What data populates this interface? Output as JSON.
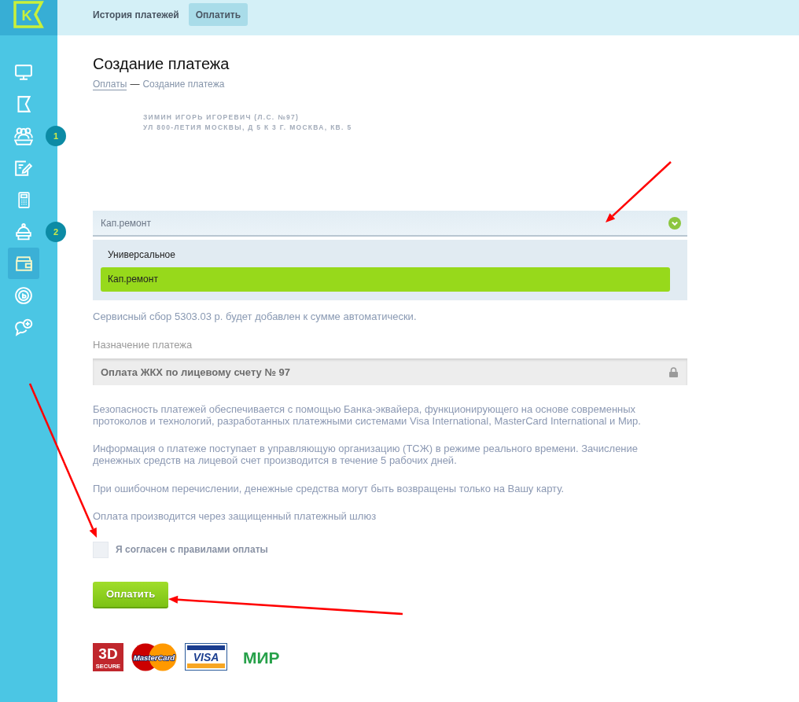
{
  "logo": {
    "text": "K"
  },
  "sidebar": {
    "items": [
      {
        "kind": "monitor",
        "selected": false
      },
      {
        "kind": "flag",
        "selected": false
      },
      {
        "kind": "people",
        "selected": false,
        "badge": "1"
      },
      {
        "kind": "note",
        "selected": false
      },
      {
        "kind": "calculator",
        "selected": false
      },
      {
        "kind": "bell",
        "selected": false,
        "badge": "2"
      },
      {
        "kind": "wallet",
        "selected": true
      },
      {
        "kind": "coin",
        "selected": false
      },
      {
        "kind": "chat",
        "selected": false
      }
    ]
  },
  "tabs": [
    {
      "label": "История платежей",
      "selected": false
    },
    {
      "label": "Оплатить",
      "selected": true
    }
  ],
  "page": {
    "title": "Создание платежа",
    "breadcrumb": {
      "link": "Оплаты",
      "separator": "—",
      "current": "Создание платежа"
    }
  },
  "account": {
    "lines": [
      "ЗИМИН ИГОРЬ ИГОРЕВИЧ (Л.С. №97)",
      "УЛ 800-ЛЕТИЯ МОСКВЫ, Д 5 К 3 Г. МОСКВА, КВ. 5"
    ]
  },
  "service_select": {
    "value": "Кап.ремонт",
    "expanded": true,
    "options": [
      {
        "label": "Универсальное",
        "selected": false
      },
      {
        "label": "Кап.ремонт",
        "selected": true
      }
    ]
  },
  "fee_note": "Сервисный сбор 5303.03 р. будет добавлен к сумме автоматически.",
  "purpose": {
    "label": "Назначение платежа",
    "value": "Оплата ЖКХ по лицевому счету № 97",
    "locked": true
  },
  "notes": [
    "Безопасность платежей обеспечивается с помощью Банка-эквайера, функционирующего на основе современных протоколов и технологий, разработанных платежными системами Visa International, MasterCard International и Мир.",
    "Информация о платеже поступает в управляющую организацию (ТСЖ) в режиме реального времени. Зачисление денежных средств на лицевой счет производится в течение 5 рабочих дней.",
    "При ошибочном перечислении, денежные средства могут быть возвращены только на Вашу карту.",
    "Оплата производится через защищенный платежный шлюз"
  ],
  "agreement": {
    "label": "Я согласен с правилами оплаты",
    "checked": false
  },
  "pay_button": {
    "label": "Оплатить"
  },
  "payment_logos": [
    {
      "kind": "secure",
      "lines": [
        "3D",
        "SECURE"
      ]
    },
    {
      "kind": "mastercard",
      "text": "MasterCard"
    },
    {
      "kind": "visa",
      "text": "VISA"
    },
    {
      "kind": "mir",
      "text": "МИР"
    }
  ]
}
